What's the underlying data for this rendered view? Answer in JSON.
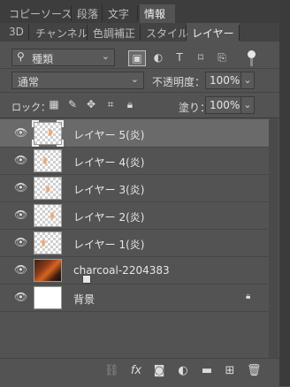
{
  "tabs_top": [
    {
      "label": "コピーソース",
      "active": false
    },
    {
      "label": "段落",
      "active": false
    },
    {
      "label": "文字",
      "active": false
    },
    {
      "label": "情報",
      "active": true
    }
  ],
  "tabs_sub": [
    {
      "label": "3D",
      "active": false
    },
    {
      "label": "チャンネル",
      "active": false
    },
    {
      "label": "色調補正",
      "active": false
    },
    {
      "label": "スタイル",
      "active": false
    },
    {
      "label": "レイヤー",
      "active": true
    }
  ],
  "filter": {
    "label": "種類"
  },
  "blend_mode": {
    "label": "通常"
  },
  "opacity": {
    "label": "不透明度：",
    "value": "100%"
  },
  "lock": {
    "label": "ロック："
  },
  "fill": {
    "label": "塗り：",
    "value": "100%"
  },
  "layers": [
    {
      "name": "レイヤー 5(炎)",
      "selected": true,
      "type": "flame"
    },
    {
      "name": "レイヤー 4(炎)",
      "selected": false,
      "type": "flame"
    },
    {
      "name": "レイヤー 3(炎)",
      "selected": false,
      "type": "flame"
    },
    {
      "name": "レイヤー 2(炎)",
      "selected": false,
      "type": "flame"
    },
    {
      "name": "レイヤー 1(炎)",
      "selected": false,
      "type": "flame"
    },
    {
      "name": "charcoal-2204383",
      "selected": false,
      "type": "smart-photo"
    },
    {
      "name": "背景",
      "selected": false,
      "type": "background",
      "locked": true
    }
  ],
  "bottom_icons": [
    "link-icon",
    "fx-icon",
    "mask-icon",
    "adjustment-icon",
    "group-folder-icon",
    "new-layer-icon",
    "trash-icon"
  ]
}
